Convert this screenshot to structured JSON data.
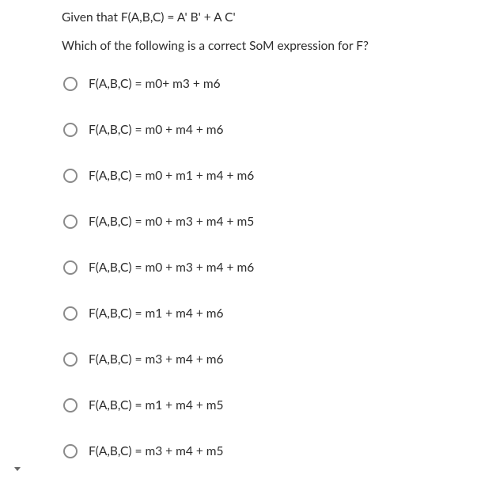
{
  "prompt": {
    "line1": "Given that F(A,B,C) = A' B' + A C'",
    "line2": "Which of the following is a correct SoM expression for F?"
  },
  "options": [
    {
      "label": "F(A,B,C) = m0+ m3 + m6"
    },
    {
      "label": "F(A,B,C) = m0 + m4 + m6"
    },
    {
      "label": "F(A,B,C) = m0 + m1 + m4 + m6"
    },
    {
      "label": "F(A,B,C) = m0 + m3 + m4 + m5"
    },
    {
      "label": "F(A,B,C) = m0 + m3 + m4 + m6"
    },
    {
      "label": "F(A,B,C) = m1 + m4 + m6"
    },
    {
      "label": "F(A,B,C) = m3 + m4 + m6"
    },
    {
      "label": "F(A,B,C) = m1 + m4 + m5"
    },
    {
      "label": "F(A,B,C) = m3 + m4 + m5"
    }
  ]
}
